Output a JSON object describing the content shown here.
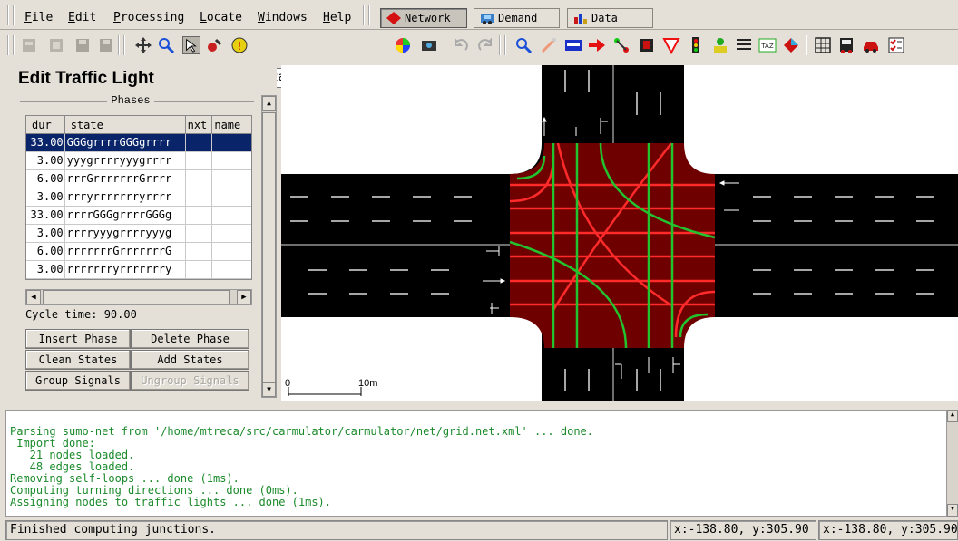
{
  "menu": {
    "items": [
      "File",
      "Edit",
      "Processing",
      "Locate",
      "Windows",
      "Help"
    ],
    "underlines": [
      "F",
      "E",
      "P",
      "L",
      "W",
      "H"
    ]
  },
  "modes": {
    "network": "Network",
    "demand": "Demand",
    "data": "Data"
  },
  "toolbar": {
    "scheme": "standard"
  },
  "panel": {
    "title": "Edit Traffic Light",
    "phases_label": "Phases",
    "columns": [
      "dur",
      "state",
      "nxt",
      "name"
    ],
    "phases": [
      {
        "dur": "33.00",
        "state": "GGGgrrrrGGGgrrrr",
        "nxt": "",
        "name": ""
      },
      {
        "dur": "3.00",
        "state": "yyygrrrryyygrrrr",
        "nxt": "",
        "name": ""
      },
      {
        "dur": "6.00",
        "state": "rrrGrrrrrrrGrrrr",
        "nxt": "",
        "name": ""
      },
      {
        "dur": "3.00",
        "state": "rrryrrrrrrryrrrr",
        "nxt": "",
        "name": ""
      },
      {
        "dur": "33.00",
        "state": "rrrrGGGgrrrrGGGg",
        "nxt": "",
        "name": ""
      },
      {
        "dur": "3.00",
        "state": "rrrryyygrrrryyyg",
        "nxt": "",
        "name": ""
      },
      {
        "dur": "6.00",
        "state": "rrrrrrrGrrrrrrrG",
        "nxt": "",
        "name": ""
      },
      {
        "dur": "3.00",
        "state": "rrrrrrryrrrrrrry",
        "nxt": "",
        "name": ""
      }
    ],
    "cycle_time": "Cycle time: 90.00",
    "buttons": {
      "insert_phase": "Insert Phase",
      "delete_phase": "Delete Phase",
      "clean_states": "Clean States",
      "add_states": "Add States",
      "group_signals": "Group Signals",
      "ungroup_signals": "Ungroup Signals"
    }
  },
  "view": {
    "scale_zero": "0",
    "scale_label": "10m",
    "colors": {
      "road": "#000000",
      "junction": "#6e0000",
      "green": "#22c32e",
      "red": "#ff2a2a"
    }
  },
  "log": {
    "separator": "---------------------------------------------------------------------------------------------------",
    "lines": [
      {
        "text": "Parsing sumo-net from '/home/mtreca/src/carmulator/carmulator/net/grid.net.xml' ... done.",
        "color": "green"
      },
      {
        "text": " Import done:",
        "color": "green"
      },
      {
        "text": "   21 nodes loaded.",
        "color": "green"
      },
      {
        "text": "   48 edges loaded.",
        "color": "green"
      },
      {
        "text": "Removing self-loops ... done (1ms).",
        "color": "green"
      },
      {
        "text": "Computing turning directions ... done (0ms).",
        "color": "green"
      },
      {
        "text": "Assigning nodes to traffic lights ... done (1ms).",
        "color": "green"
      }
    ]
  },
  "status": {
    "message": "Finished computing junctions.",
    "coord1": "x:-138.80, y:305.90",
    "coord2": "x:-138.80, y:305.90"
  }
}
